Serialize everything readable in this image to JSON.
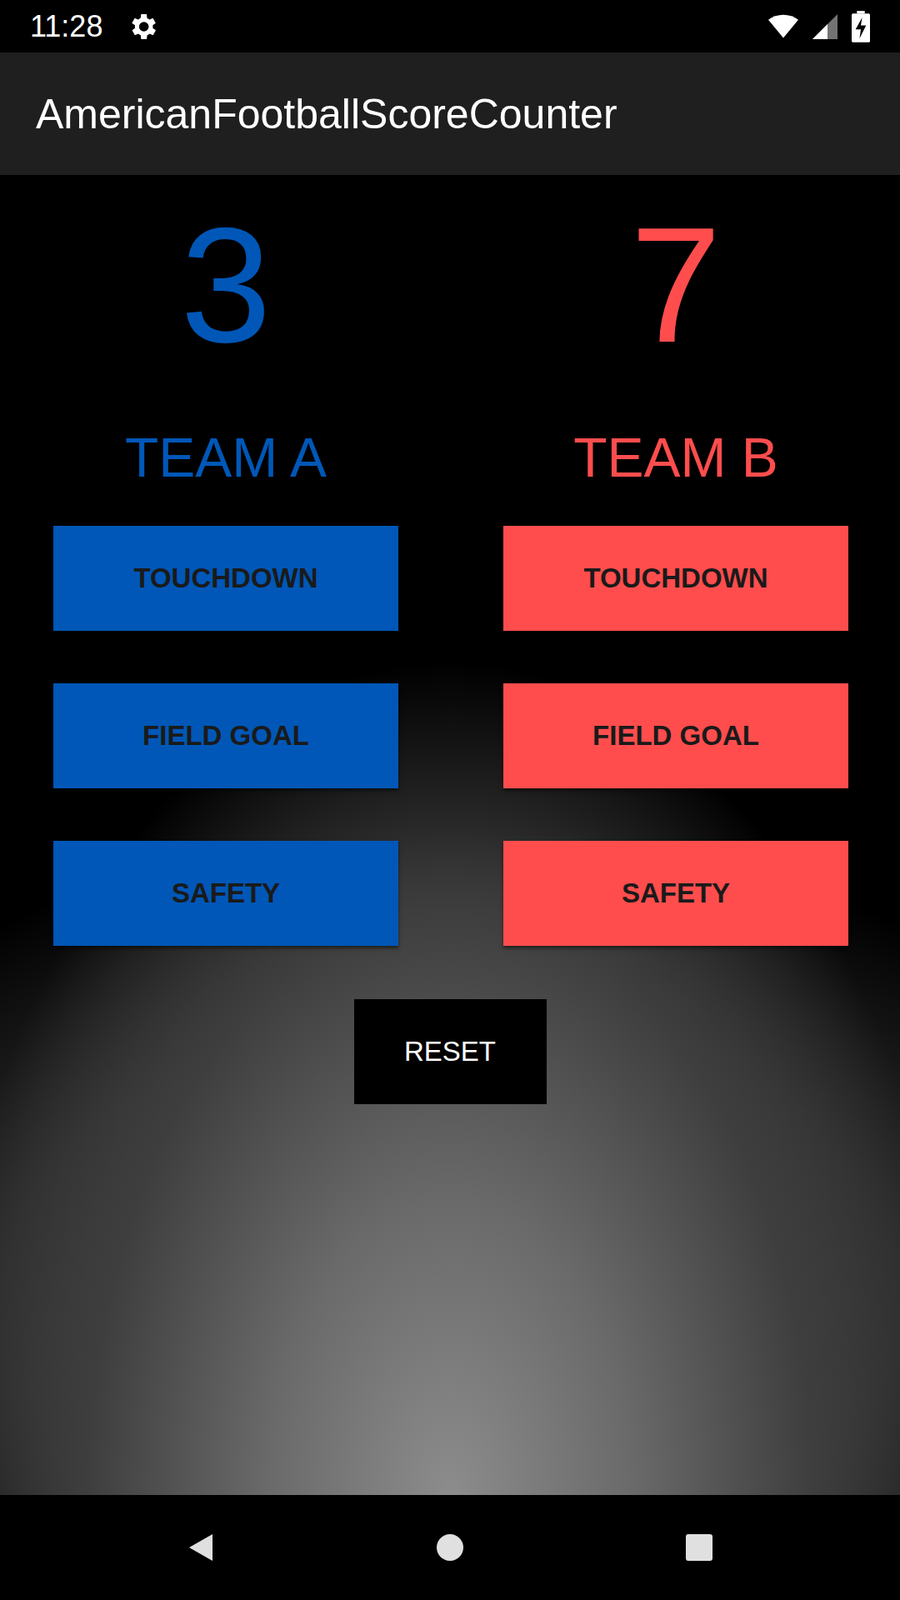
{
  "status_bar": {
    "time": "11:28"
  },
  "app_bar": {
    "title": "AmericanFootballScoreCounter"
  },
  "teams": [
    {
      "name": "TEAM A",
      "score": "3",
      "color": "#0057b7",
      "buttons": [
        "TOUCHDOWN",
        "FIELD GOAL",
        "SAFETY"
      ]
    },
    {
      "name": "TEAM B",
      "score": "7",
      "color": "#ff4d4d",
      "buttons": [
        "TOUCHDOWN",
        "FIELD GOAL",
        "SAFETY"
      ]
    }
  ],
  "reset": {
    "label": "RESET"
  }
}
